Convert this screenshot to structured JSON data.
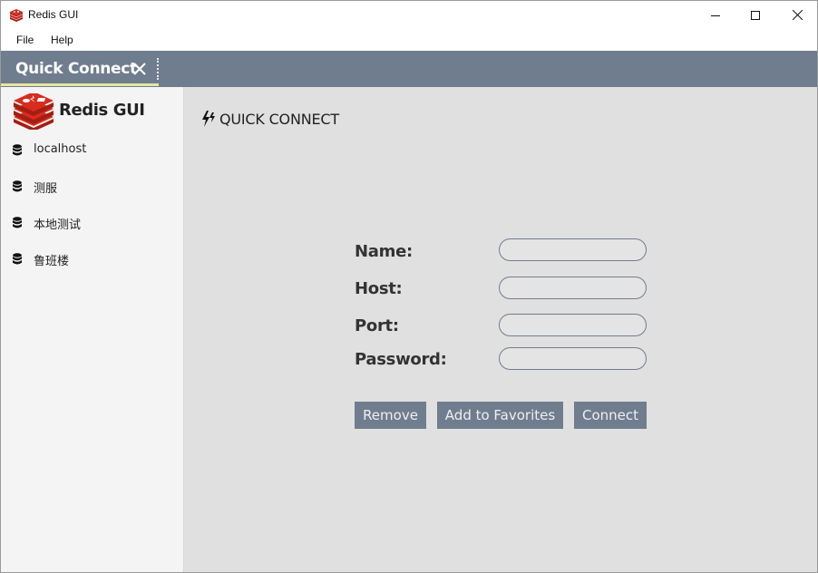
{
  "window": {
    "title": "Redis GUI"
  },
  "menu": {
    "items": [
      {
        "label": "File"
      },
      {
        "label": "Help"
      }
    ]
  },
  "tabs": [
    {
      "label": "Quick Connect",
      "active": true
    }
  ],
  "sidebar": {
    "app_name": "Redis GUI",
    "connections": [
      {
        "label": "localhost"
      },
      {
        "label": "测服"
      },
      {
        "label": "本地测试"
      },
      {
        "label": "鲁班楼"
      }
    ]
  },
  "main": {
    "section_title": "QUICK CONNECT",
    "form": {
      "name_label": "Name:",
      "host_label": "Host:",
      "port_label": "Port:",
      "password_label": "Password:",
      "name_value": "",
      "host_value": "",
      "port_value": "",
      "password_value": ""
    },
    "buttons": {
      "remove": "Remove",
      "add_favorites": "Add to Favorites",
      "connect": "Connect"
    }
  },
  "colors": {
    "accent": "#707d8f",
    "tab_underline": "#e6e6a0",
    "sidebar_bg": "#f4f4f4",
    "main_bg": "#e0e0e0",
    "redis_red": "#d82c20"
  },
  "icons": {
    "app": "redis-logo-icon",
    "tab_close": "close-icon",
    "connection": "database-icon",
    "section": "lightning-icon"
  }
}
